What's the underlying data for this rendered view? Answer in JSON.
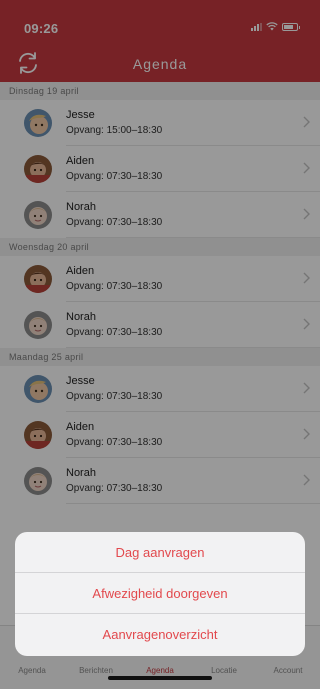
{
  "status_bar": {
    "time": "09:26",
    "icons": [
      "signal-icon",
      "wifi-icon",
      "battery-icon"
    ]
  },
  "header": {
    "title": "Agenda",
    "refresh_icon": "refresh-icon"
  },
  "sections": [
    {
      "date": "Dinsdag 19 april",
      "rows": [
        {
          "name": "Jesse",
          "time": "Opvang: 15:00–18:30",
          "avatar": "child-1"
        },
        {
          "name": "Aiden",
          "time": "Opvang: 07:30–18:30",
          "avatar": "child-2"
        },
        {
          "name": "Norah",
          "time": "Opvang: 07:30–18:30",
          "avatar": "child-3"
        }
      ]
    },
    {
      "date": "Woensdag 20 april",
      "rows": [
        {
          "name": "Aiden",
          "time": "Opvang: 07:30–18:30",
          "avatar": "child-2"
        },
        {
          "name": "Norah",
          "time": "Opvang: 07:30–18:30",
          "avatar": "child-3"
        }
      ]
    },
    {
      "date": "Maandag 25 april",
      "rows": [
        {
          "name": "Jesse",
          "time": "Opvang: 07:30–18:30",
          "avatar": "child-1"
        },
        {
          "name": "Aiden",
          "time": "Opvang: 07:30–18:30",
          "avatar": "child-2"
        },
        {
          "name": "Norah",
          "time": "Opvang: 07:30–18:30",
          "avatar": "child-3"
        }
      ]
    }
  ],
  "tabbar": {
    "items": [
      "Agenda",
      "Berichten",
      "Agenda",
      "Locatie",
      "Account"
    ],
    "active_index": 2
  },
  "action_sheet": {
    "actions": [
      "Dag aanvragen",
      "Afwezigheid doorgeven",
      "Aanvragenoverzicht"
    ]
  },
  "colors": {
    "brand": "#c63a40",
    "action_text": "#e2494d",
    "section_bg": "#f1f1f1"
  }
}
